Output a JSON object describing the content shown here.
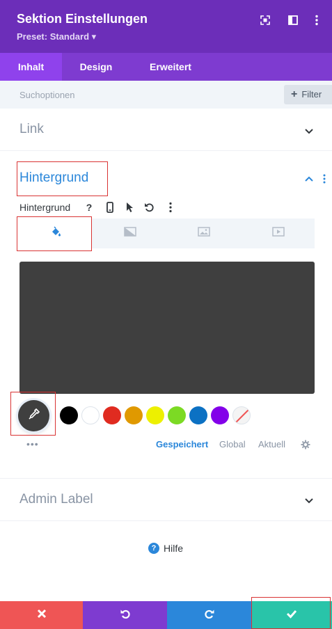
{
  "header": {
    "title": "Sektion Einstellungen",
    "preset": "Preset: Standard ▾",
    "icons": [
      "fullscreen-icon",
      "sidebar-icon",
      "more-icon"
    ]
  },
  "tabs": [
    {
      "label": "Inhalt",
      "active": true
    },
    {
      "label": "Design",
      "active": false
    },
    {
      "label": "Erweitert",
      "active": false
    }
  ],
  "search": {
    "placeholder": "Suchoptionen",
    "filter_label": "Filter"
  },
  "sections": {
    "link": "Link",
    "hintergrund": "Hintergrund",
    "admin_label": "Admin Label"
  },
  "background": {
    "label": "Hintergrund",
    "tabs": [
      "paint-bucket-icon",
      "gradient-icon",
      "image-icon",
      "video-icon"
    ],
    "current_color": "#3f3f3f"
  },
  "palette": {
    "swatches": [
      "#000000",
      "#ffffff",
      "#e02b20",
      "#e09900",
      "#edf000",
      "#7cda24",
      "#0c71c3",
      "#8300e9",
      "none"
    ],
    "more": "•••",
    "tabs": [
      {
        "label": "Gespeichert",
        "active": true
      },
      {
        "label": "Global",
        "active": false
      },
      {
        "label": "Aktuell",
        "active": false
      }
    ]
  },
  "help": {
    "label": "Hilfe"
  },
  "footer": {
    "colors": {
      "cancel": "#ef5555",
      "undo": "#7e3bd0",
      "redo": "#2b87da",
      "save": "#29c4a9"
    }
  }
}
